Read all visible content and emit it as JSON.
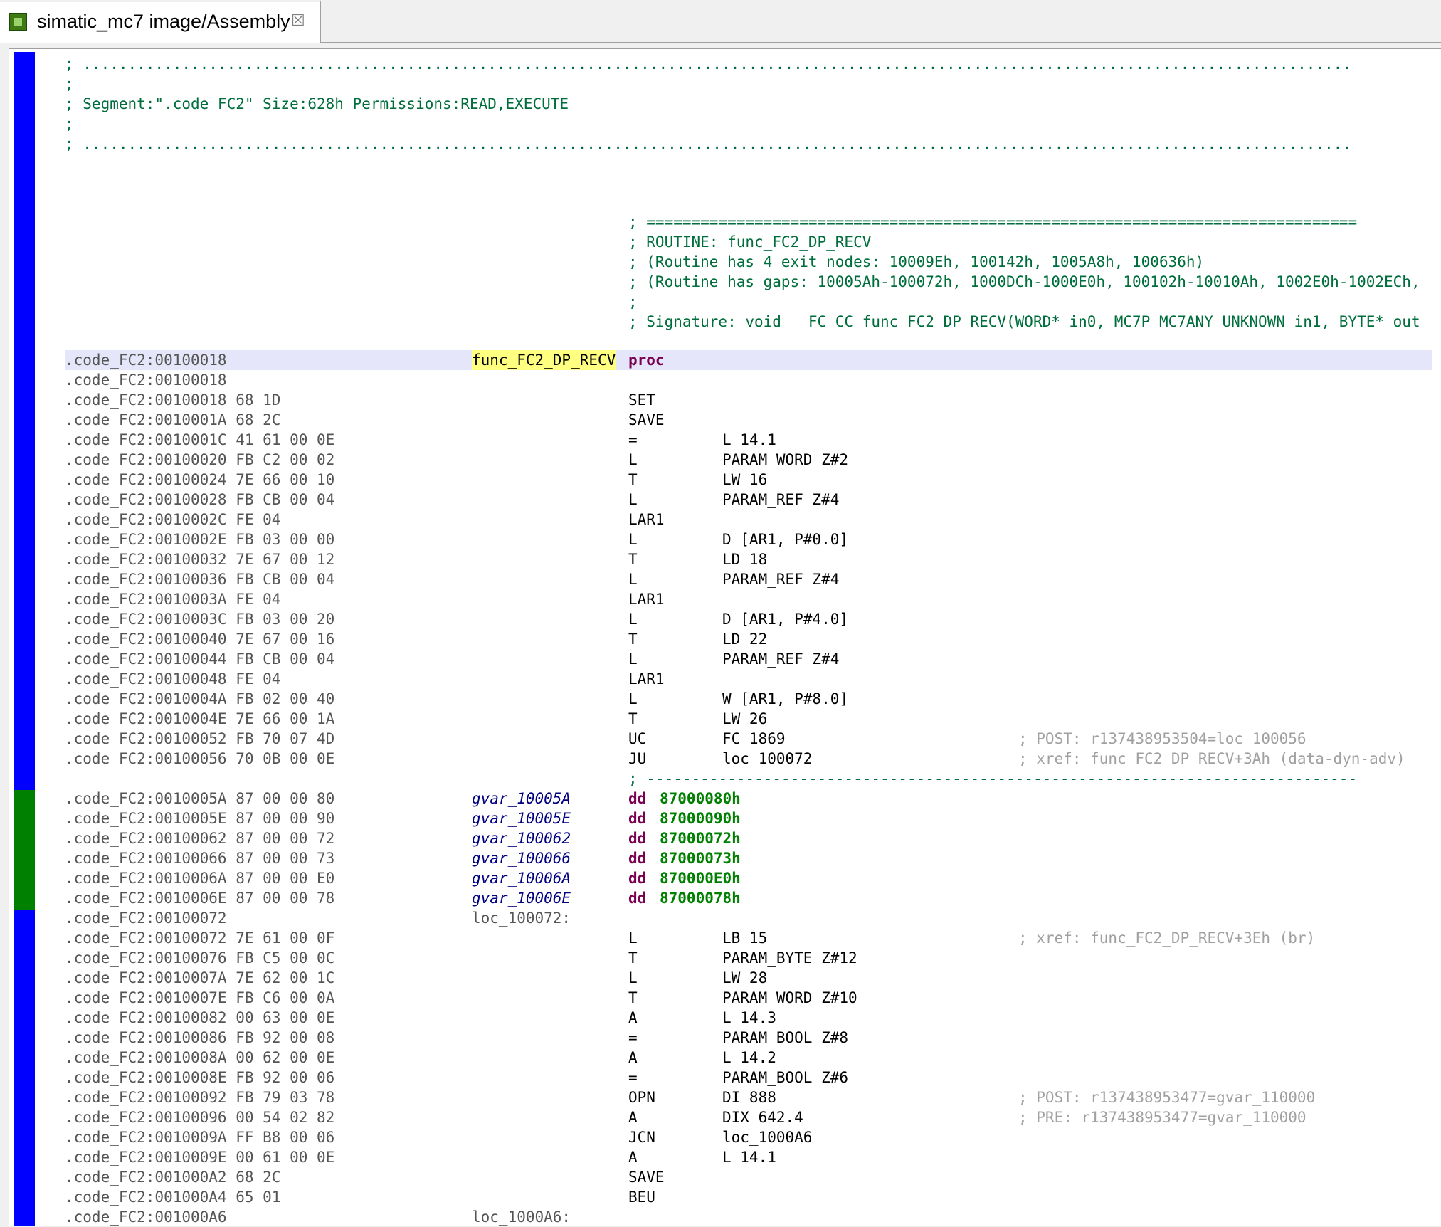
{
  "tab": {
    "title": "simatic_mc7 image/Assembly",
    "icon": "chip-icon",
    "close_icon": "close-icon"
  },
  "header_lines": [
    "; .............................................................................................................................................",
    ";",
    "; Segment:\".code_FC2\" Size:628h Permissions:READ,EXECUTE",
    ";",
    "; ............................................................................................................................................."
  ],
  "routine_comment": [
    "; ===============================================================================",
    "; ROUTINE: func_FC2_DP_RECV",
    "; (Routine has 4 exit nodes: 10009Eh, 100142h, 1005A8h, 100636h)",
    "; (Routine has gaps: 10005Ah-100072h, 1000DCh-1000E0h, 100102h-10010Ah, 1002E0h-1002ECh,",
    ";",
    "; Signature: void __FC_CC func_FC2_DP_RECV(WORD* in0, MC7P_MC7ANY_UNKNOWN in1, BYTE* out"
  ],
  "proc_line": {
    "addr": ".code_FC2:00100018",
    "name": "func_FC2_DP_RECV",
    "keyword": "proc"
  },
  "lines_a": [
    {
      "addr": ".code_FC2:00100018",
      "bytes": "",
      "mn": "",
      "op": "",
      "cm": ""
    },
    {
      "addr": ".code_FC2:00100018",
      "bytes": "68 1D",
      "mn": "SET",
      "op": "",
      "cm": ""
    },
    {
      "addr": ".code_FC2:0010001A",
      "bytes": "68 2C",
      "mn": "SAVE",
      "op": "",
      "cm": ""
    },
    {
      "addr": ".code_FC2:0010001C",
      "bytes": "41 61 00 0E",
      "mn": "=",
      "op": "L 14.1",
      "cm": ""
    },
    {
      "addr": ".code_FC2:00100020",
      "bytes": "FB C2 00 02",
      "mn": "L",
      "op": "PARAM_WORD Z#2",
      "cm": ""
    },
    {
      "addr": ".code_FC2:00100024",
      "bytes": "7E 66 00 10",
      "mn": "T",
      "op": "LW 16",
      "cm": ""
    },
    {
      "addr": ".code_FC2:00100028",
      "bytes": "FB CB 00 04",
      "mn": "L",
      "op": "PARAM_REF Z#4",
      "cm": ""
    },
    {
      "addr": ".code_FC2:0010002C",
      "bytes": "FE 04",
      "mn": "LAR1",
      "op": "",
      "cm": ""
    },
    {
      "addr": ".code_FC2:0010002E",
      "bytes": "FB 03 00 00",
      "mn": "L",
      "op": "D [AR1, P#0.0]",
      "cm": ""
    },
    {
      "addr": ".code_FC2:00100032",
      "bytes": "7E 67 00 12",
      "mn": "T",
      "op": "LD 18",
      "cm": ""
    },
    {
      "addr": ".code_FC2:00100036",
      "bytes": "FB CB 00 04",
      "mn": "L",
      "op": "PARAM_REF Z#4",
      "cm": ""
    },
    {
      "addr": ".code_FC2:0010003A",
      "bytes": "FE 04",
      "mn": "LAR1",
      "op": "",
      "cm": ""
    },
    {
      "addr": ".code_FC2:0010003C",
      "bytes": "FB 03 00 20",
      "mn": "L",
      "op": "D [AR1, P#4.0]",
      "cm": ""
    },
    {
      "addr": ".code_FC2:00100040",
      "bytes": "7E 67 00 16",
      "mn": "T",
      "op": "LD 22",
      "cm": ""
    },
    {
      "addr": ".code_FC2:00100044",
      "bytes": "FB CB 00 04",
      "mn": "L",
      "op": "PARAM_REF Z#4",
      "cm": ""
    },
    {
      "addr": ".code_FC2:00100048",
      "bytes": "FE 04",
      "mn": "LAR1",
      "op": "",
      "cm": ""
    },
    {
      "addr": ".code_FC2:0010004A",
      "bytes": "FB 02 00 40",
      "mn": "L",
      "op": "W [AR1, P#8.0]",
      "cm": ""
    },
    {
      "addr": ".code_FC2:0010004E",
      "bytes": "7E 66 00 1A",
      "mn": "T",
      "op": "LW 26",
      "cm": ""
    },
    {
      "addr": ".code_FC2:00100052",
      "bytes": "FB 70 07 4D",
      "mn": "UC",
      "op": "FC 1869",
      "cm": "; POST: r137438953504=loc_100056"
    },
    {
      "addr": ".code_FC2:00100056",
      "bytes": "70 0B 00 0E",
      "mn": "JU",
      "op": "loc_100072",
      "cm": "; xref: func_FC2_DP_RECV+3Ah (data-dyn-adv)"
    }
  ],
  "separator": "; -------------------------------------------------------------------------------",
  "data_lines": [
    {
      "addr": ".code_FC2:0010005A",
      "bytes": "87 00 00 80",
      "label": "gvar_10005A",
      "dir": "dd",
      "val": "87000080h"
    },
    {
      "addr": ".code_FC2:0010005E",
      "bytes": "87 00 00 90",
      "label": "gvar_10005E",
      "dir": "dd",
      "val": "87000090h"
    },
    {
      "addr": ".code_FC2:00100062",
      "bytes": "87 00 00 72",
      "label": "gvar_100062",
      "dir": "dd",
      "val": "87000072h"
    },
    {
      "addr": ".code_FC2:00100066",
      "bytes": "87 00 00 73",
      "label": "gvar_100066",
      "dir": "dd",
      "val": "87000073h"
    },
    {
      "addr": ".code_FC2:0010006A",
      "bytes": "87 00 00 E0",
      "label": "gvar_10006A",
      "dir": "dd",
      "val": "870000E0h"
    },
    {
      "addr": ".code_FC2:0010006E",
      "bytes": "87 00 00 78",
      "label": "gvar_10006E",
      "dir": "dd",
      "val": "87000078h"
    }
  ],
  "loc_line_1": {
    "addr": ".code_FC2:00100072",
    "label": "loc_100072:"
  },
  "lines_b": [
    {
      "addr": ".code_FC2:00100072",
      "bytes": "7E 61 00 0F",
      "mn": "L",
      "op": "LB 15",
      "cm": "; xref: func_FC2_DP_RECV+3Eh (br)"
    },
    {
      "addr": ".code_FC2:00100076",
      "bytes": "FB C5 00 0C",
      "mn": "T",
      "op": "PARAM_BYTE Z#12",
      "cm": ""
    },
    {
      "addr": ".code_FC2:0010007A",
      "bytes": "7E 62 00 1C",
      "mn": "L",
      "op": "LW 28",
      "cm": ""
    },
    {
      "addr": ".code_FC2:0010007E",
      "bytes": "FB C6 00 0A",
      "mn": "T",
      "op": "PARAM_WORD Z#10",
      "cm": ""
    },
    {
      "addr": ".code_FC2:00100082",
      "bytes": "00 63 00 0E",
      "mn": "A",
      "op": "L 14.3",
      "cm": ""
    },
    {
      "addr": ".code_FC2:00100086",
      "bytes": "FB 92 00 08",
      "mn": "=",
      "op": "PARAM_BOOL Z#8",
      "cm": ""
    },
    {
      "addr": ".code_FC2:0010008A",
      "bytes": "00 62 00 0E",
      "mn": "A",
      "op": "L 14.2",
      "cm": ""
    },
    {
      "addr": ".code_FC2:0010008E",
      "bytes": "FB 92 00 06",
      "mn": "=",
      "op": "PARAM_BOOL Z#6",
      "cm": ""
    },
    {
      "addr": ".code_FC2:00100092",
      "bytes": "FB 79 03 78",
      "mn": "OPN",
      "op": "DI 888",
      "cm": "; POST: r137438953477=gvar_110000"
    },
    {
      "addr": ".code_FC2:00100096",
      "bytes": "00 54 02 82",
      "mn": "A",
      "op": "DIX 642.4",
      "cm": "; PRE: r137438953477=gvar_110000"
    },
    {
      "addr": ".code_FC2:0010009A",
      "bytes": "FF B8 00 06",
      "mn": "JCN",
      "op": "loc_1000A6",
      "cm": ""
    },
    {
      "addr": ".code_FC2:0010009E",
      "bytes": "00 61 00 0E",
      "mn": "A",
      "op": "L 14.1",
      "cm": ""
    },
    {
      "addr": ".code_FC2:001000A2",
      "bytes": "68 2C",
      "mn": "SAVE",
      "op": "",
      "cm": ""
    },
    {
      "addr": ".code_FC2:001000A4",
      "bytes": "65 01",
      "mn": "BEU",
      "op": "",
      "cm": ""
    }
  ],
  "loc_line_2": {
    "addr": ".code_FC2:001000A6",
    "label": "loc_1000A6:"
  },
  "colors": {
    "code_bar": "#0000ff",
    "data_bar": "#008000",
    "comment_green": "#006e3c",
    "highlight_line": "#e6e6fa",
    "proc_name_bg": "#ffff80"
  }
}
